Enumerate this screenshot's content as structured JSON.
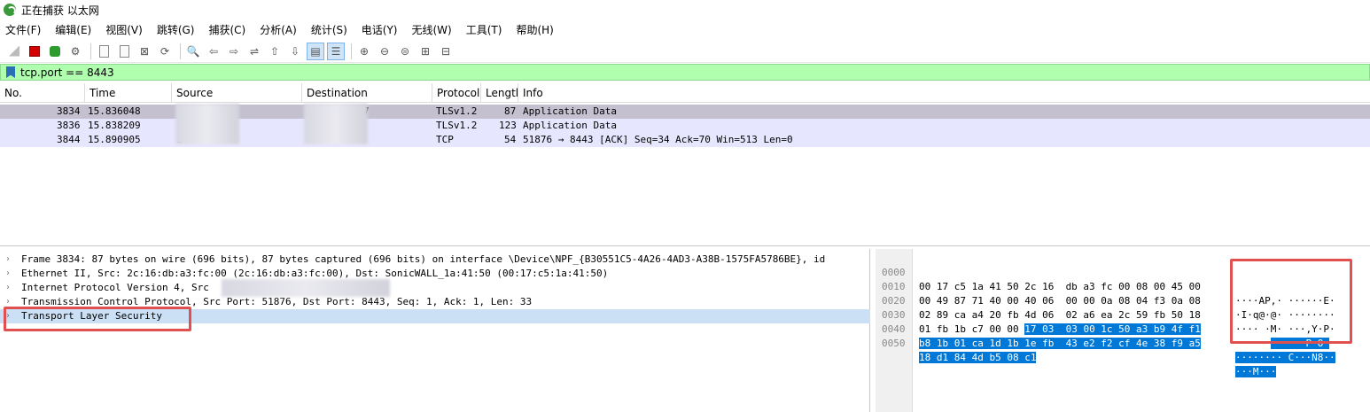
{
  "window": {
    "title": "正在捕获 以太网"
  },
  "menu": [
    "文件(F)",
    "编辑(E)",
    "视图(V)",
    "跳转(G)",
    "捕获(C)",
    "分析(A)",
    "统计(S)",
    "电话(Y)",
    "无线(W)",
    "工具(T)",
    "帮助(H)"
  ],
  "filter": {
    "value": "tcp.port == 8443"
  },
  "columns": [
    "No.",
    "Time",
    "Source",
    "Destination",
    "Protocol",
    "Lengtl",
    "Info"
  ],
  "packets": [
    {
      "no": "3834",
      "time": "15.836048",
      "source": "",
      "destination": "7",
      "protocol": "TLSv1.2",
      "length": "87",
      "info": "Application Data"
    },
    {
      "no": "3836",
      "time": "15.838209",
      "source": "",
      "destination": "",
      "protocol": "TLSv1.2",
      "length": "123",
      "info": "Application Data"
    },
    {
      "no": "3844",
      "time": "15.890905",
      "source": "1",
      "destination": "",
      "protocol": "TCP",
      "length": "54",
      "info": "51876 → 8443 [ACK] Seq=34 Ack=70 Win=513 Len=0"
    }
  ],
  "details": [
    "Frame 3834: 87 bytes on wire (696 bits), 87 bytes captured (696 bits) on interface \\Device\\NPF_{B30551C5-4A26-4AD3-A38B-1575FA5786BE}, id",
    "Ethernet II, Src: 2c:16:db:a3:fc:00 (2c:16:db:a3:fc:00), Dst: SonicWALL_1a:41:50 (00:17:c5:1a:41:50)",
    "Internet Protocol Version 4, Src",
    "Transmission Control Protocol, Src Port: 51876, Dst Port: 8443, Seq: 1, Ack: 1, Len: 33",
    "Transport Layer Security"
  ],
  "bytes": [
    {
      "offset": "0000",
      "hex_pre": "00 17 c5 1a 41 50 2c 16  db a3 fc 00 08 00 45 00",
      "hex_sel": "",
      "ascii_pre": "····AP,· ······E·",
      "ascii_sel": ""
    },
    {
      "offset": "0010",
      "hex_pre": "00 49 87 71 40 00 40 06  00 00 0a 08 04 f3 0a 08",
      "hex_sel": "",
      "ascii_pre": "·I·q@·@· ········",
      "ascii_sel": ""
    },
    {
      "offset": "0020",
      "hex_pre": "02 89 ca a4 20 fb 4d 06  02 a6 ea 2c 59 fb 50 18",
      "hex_sel": "",
      "ascii_pre": "···· ·M· ···,Y·P·",
      "ascii_sel": ""
    },
    {
      "offset": "0030",
      "hex_pre": "01 fb 1b c7 00 00 ",
      "hex_sel": "17 03  03 00 1c 50 a3 b9 4f f1",
      "ascii_pre": "······",
      "ascii_sel": "·· ···P·O·"
    },
    {
      "offset": "0040",
      "hex_pre": "",
      "hex_sel": "b8 1b 01 ca 1d 1b 1e fb  43 e2 f2 cf 4e 38 f9 a5",
      "ascii_pre": "",
      "ascii_sel": "········ C···N8··"
    },
    {
      "offset": "0050",
      "hex_pre": "",
      "hex_sel": "18 d1 84 4d b5 08 c1",
      "ascii_pre": "",
      "ascii_sel": "···M···"
    }
  ]
}
